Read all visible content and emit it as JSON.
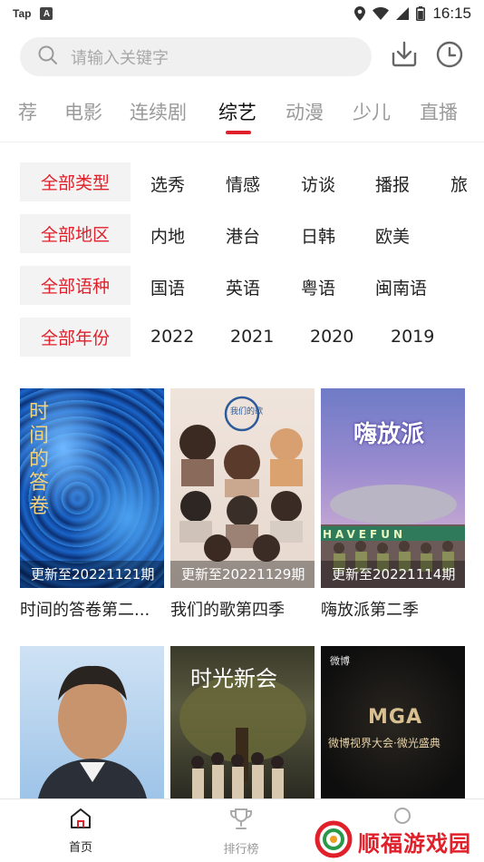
{
  "status_bar": {
    "left_text": "Tap",
    "left_badge": "A",
    "time": "16:15"
  },
  "search": {
    "placeholder": "请输入关键字"
  },
  "tabs": [
    {
      "label": "荐"
    },
    {
      "label": "电影"
    },
    {
      "label": "连续剧"
    },
    {
      "label": "综艺",
      "active": true
    },
    {
      "label": "动漫"
    },
    {
      "label": "少儿"
    },
    {
      "label": "直播"
    }
  ],
  "filters": {
    "type": {
      "selected": "全部类型",
      "options": [
        "选秀",
        "情感",
        "访谈",
        "播报",
        "旅"
      ]
    },
    "region": {
      "selected": "全部地区",
      "options": [
        "内地",
        "港台",
        "日韩",
        "欧美"
      ]
    },
    "language": {
      "selected": "全部语种",
      "options": [
        "国语",
        "英语",
        "粤语",
        "闽南语"
      ]
    },
    "year": {
      "selected": "全部年份",
      "options": [
        "2022",
        "2021",
        "2020",
        "2019"
      ]
    }
  },
  "shows": [
    {
      "title": "时间的答卷第二...",
      "update": "更新至20221121期",
      "poster_text": "时间的答卷"
    },
    {
      "title": "我们的歌第四季",
      "update": "更新至20221129期",
      "poster_text": "我们的歌"
    },
    {
      "title": "嗨放派第二季",
      "update": "更新至20221114期",
      "poster_text": "嗨放派",
      "poster_subtext": "HAVEFUN"
    },
    {
      "title": "",
      "update": ""
    },
    {
      "title": "",
      "update": "",
      "poster_text": "时光新会"
    },
    {
      "title": "",
      "update": "",
      "poster_text": "微博视界大会·微光盛典",
      "poster_logo": "MGA",
      "poster_corner": "微博"
    }
  ],
  "bottom_nav": [
    {
      "label": "首页",
      "icon": "home-icon",
      "active": true
    },
    {
      "label": "排行榜",
      "icon": "trophy-icon"
    },
    {
      "label": "",
      "icon": "user-icon"
    }
  ],
  "watermark": {
    "text": "顺福游戏园"
  },
  "colors": {
    "accent": "#e0202a",
    "chip_bg": "#f3f3f3",
    "search_bg": "#f0f0f0"
  }
}
